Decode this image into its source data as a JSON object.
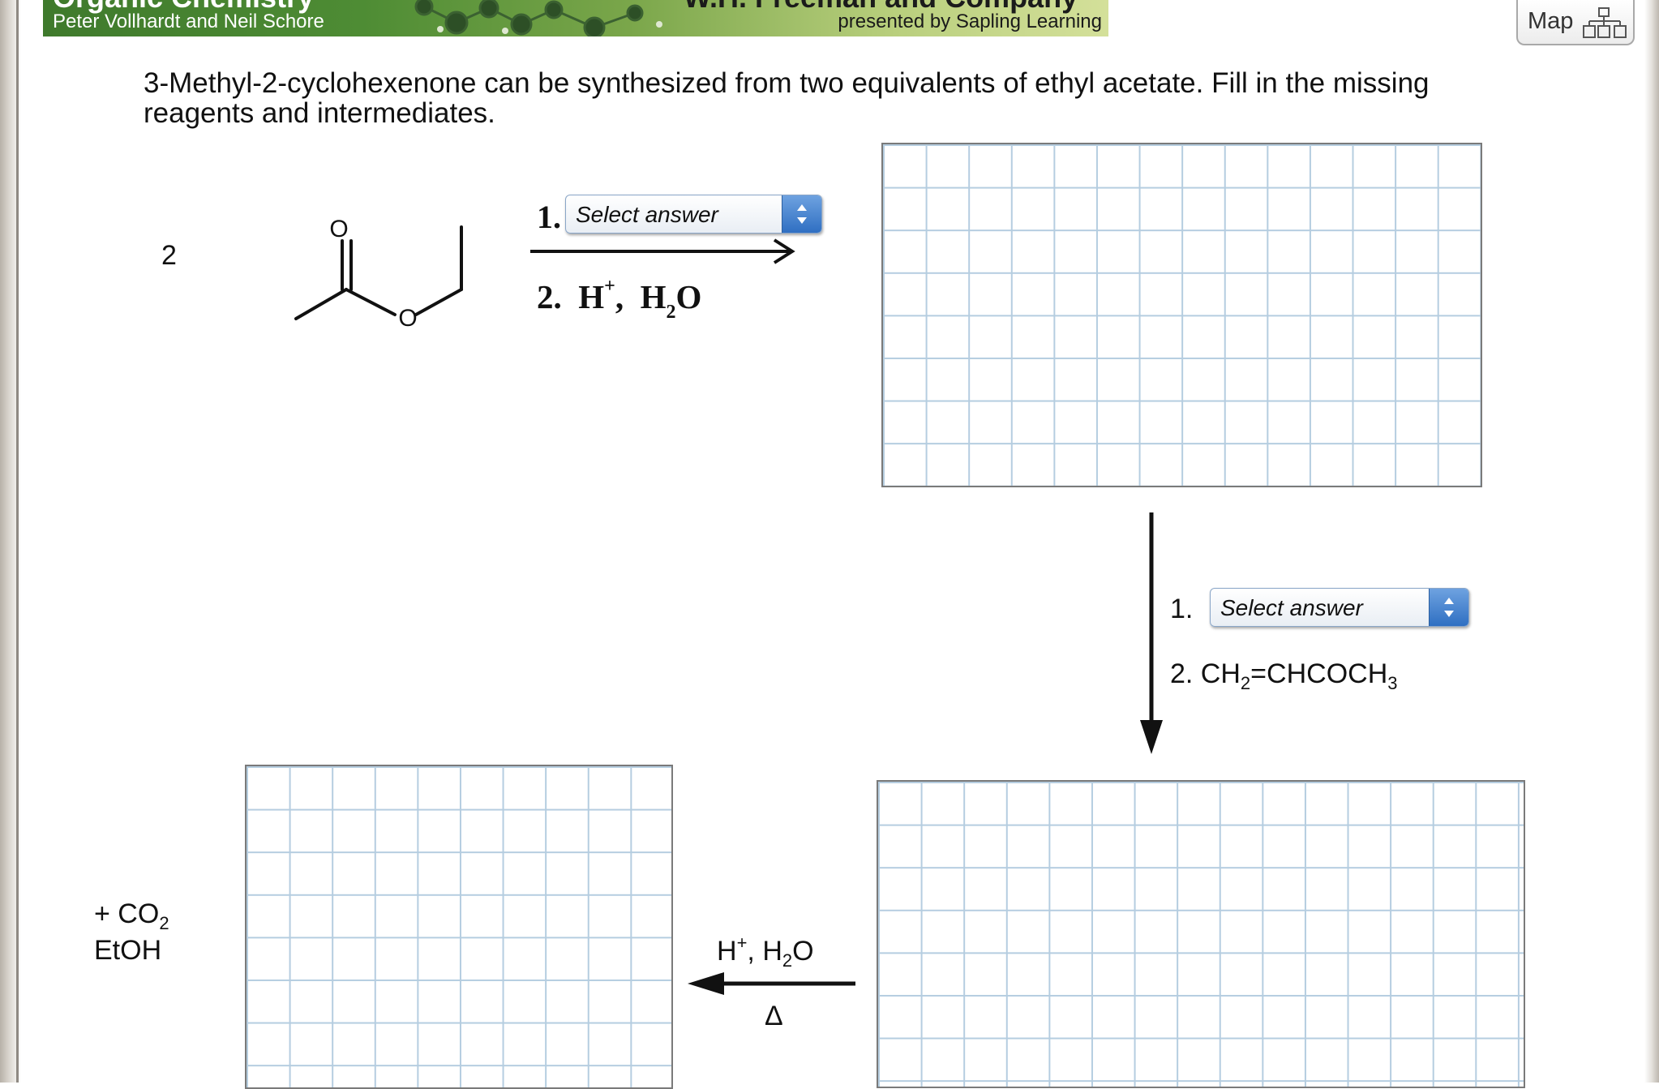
{
  "header": {
    "title_clipped": "Organic Chemistry",
    "authors": "Peter Vollhardt and Neil Schore",
    "publisher_clipped": "W.H. Freeman and Company",
    "presented_by": "presented by Sapling Learning"
  },
  "map_button": {
    "label": "Map",
    "icon": "map-tree-icon"
  },
  "question": {
    "text": "3-Methyl-2-cyclohexenone can be synthesized from two equivalents of ethyl acetate. Fill in the missing reagents and intermediates."
  },
  "starting_material": {
    "coefficient": "2",
    "atom_labels": [
      "O",
      "O"
    ],
    "name_hidden": "ethyl acetate"
  },
  "step1": {
    "num1": "1.",
    "num2": "2.",
    "reagent2": {
      "H": "H",
      "plus": "+",
      "comma": ",",
      "H2": "H",
      "sub2": "2",
      "O": "O"
    },
    "dropdown": {
      "selected": "Select answer"
    }
  },
  "step2": {
    "num1": "1.",
    "dropdown": {
      "selected": "Select answer"
    },
    "reagent2": {
      "prefix": "2. CH",
      "sub_a": "2",
      "middle": "=CHCOCH",
      "sub_b": "3"
    }
  },
  "step3": {
    "reagent": {
      "H": "H",
      "plus": "+",
      "rest": ", H",
      "sub2": "2",
      "O": "O"
    },
    "condition": "Δ"
  },
  "byproducts": {
    "line1": {
      "prefix": "+ CO",
      "sub": "2"
    },
    "line2": "EtOH"
  },
  "colors": {
    "grid_line": "#b5cde0",
    "banner_green": "#4e8c34",
    "dropdown_blue": "#2f6fc2"
  }
}
